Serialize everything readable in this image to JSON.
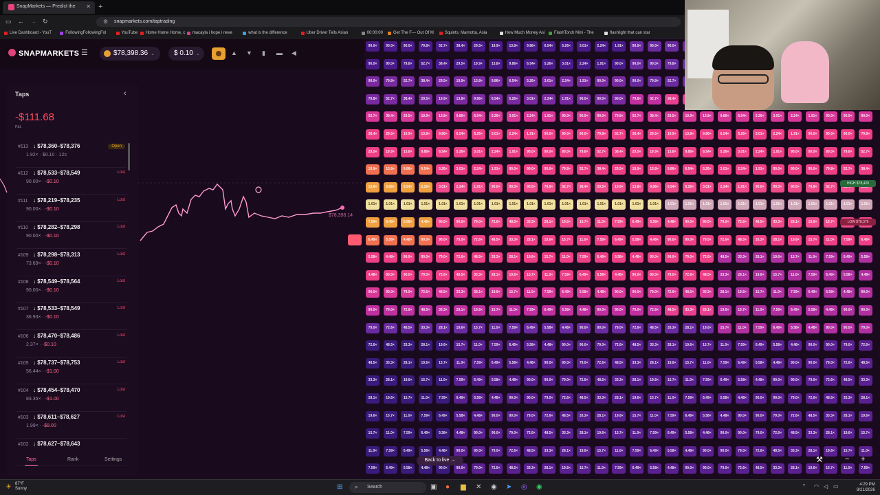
{
  "browser": {
    "tab_title": "SnapMarkets — Predict the",
    "url": "snapmarkets.com/taptrading",
    "bookmarks": [
      {
        "label": "Live Dashboard - YouT",
        "color": "#e02020"
      },
      {
        "label": "FollowingFollowingFol",
        "color": "#a040e0"
      },
      {
        "label": "YouTube",
        "color": "#e02020"
      },
      {
        "label": "Home Home Home, c",
        "color": "#e02020"
      },
      {
        "label": "macayla i hope i neve",
        "color": "#d04080"
      },
      {
        "label": "what is the difference",
        "color": "#40a0e0"
      },
      {
        "label": "Uber Driver Tells Asian",
        "color": "#e02020"
      },
      {
        "label": "00:00:00",
        "color": "#888888"
      },
      {
        "label": "Get The F— Out Of M",
        "color": "#e08020"
      },
      {
        "label": "Squints, Marnotta, Asia",
        "color": "#e02020"
      },
      {
        "label": "How Much Money Asi",
        "color": "#dddddd"
      },
      {
        "label": "FlashTorch Mini - The",
        "color": "#40a040"
      },
      {
        "label": "flashlight that can star",
        "color": "#dddddd"
      }
    ]
  },
  "app": {
    "logo": "SNAPMARKETS",
    "balance": "$78,398.36",
    "bet_amount": "$ 0.10",
    "back_to_live": "Back to live →"
  },
  "sidebar": {
    "title": "Taps",
    "pnl": "-$111.68",
    "pnl_label": "P&L",
    "trades": [
      {
        "id": "#113",
        "range": "↓ $78,360–$78,376",
        "meta": "1.92× · $0.10 · 12s",
        "loss": "",
        "status": "Open"
      },
      {
        "id": "#112",
        "range": "↓ $78,533–$78,549",
        "meta": "90.00× ·",
        "loss": "-$0.10",
        "status": "Lost"
      },
      {
        "id": "#111",
        "range": "↓ $78,219–$78,235",
        "meta": "90.00× ·",
        "loss": "-$0.10",
        "status": "Lost"
      },
      {
        "id": "#110",
        "range": "↓ $78,282–$78,298",
        "meta": "90.00× ·",
        "loss": "-$0.10",
        "status": "Lost"
      },
      {
        "id": "#109",
        "range": "↓ $78,298–$78,313",
        "meta": "73.69× ·",
        "loss": "-$0.10",
        "status": "Lost"
      },
      {
        "id": "#108",
        "range": "↓ $78,549–$78,564",
        "meta": "90.00× ·",
        "loss": "-$0.10",
        "status": "Lost"
      },
      {
        "id": "#107",
        "range": "↓ $78,533–$78,549",
        "meta": "36.93× ·",
        "loss": "-$0.10",
        "status": "Lost"
      },
      {
        "id": "#106",
        "range": "↓ $78,470–$78,486",
        "meta": "2.37× ·",
        "loss": "-$0.10",
        "status": "Lost"
      },
      {
        "id": "#105",
        "range": "↓ $78,737–$78,753",
        "meta": "56.44× ·",
        "loss": "-$1.00",
        "status": "Lost"
      },
      {
        "id": "#104",
        "range": "↓ $78,454–$78,470",
        "meta": "83.35× ·",
        "loss": "-$1.00",
        "status": "Lost"
      },
      {
        "id": "#103",
        "range": "↓ $78,611–$78,627",
        "meta": "1.99× ·",
        "loss": "-$8.00",
        "status": "Lost"
      },
      {
        "id": "#102",
        "range": "↓ $78,627–$78,643",
        "meta": "",
        "loss": "",
        "status": ""
      }
    ],
    "tabs": [
      "Taps",
      "Rank",
      "Settings"
    ]
  },
  "chart": {
    "price_label": "$78,398.14",
    "high_label": "HIGH $78,420",
    "low_label": "LOW $78,376"
  },
  "taskbar": {
    "weather_temp": "87°F",
    "weather_desc": "Sunny",
    "search": "Search",
    "time": "4:29 PM",
    "date": "8/21/2026"
  }
}
